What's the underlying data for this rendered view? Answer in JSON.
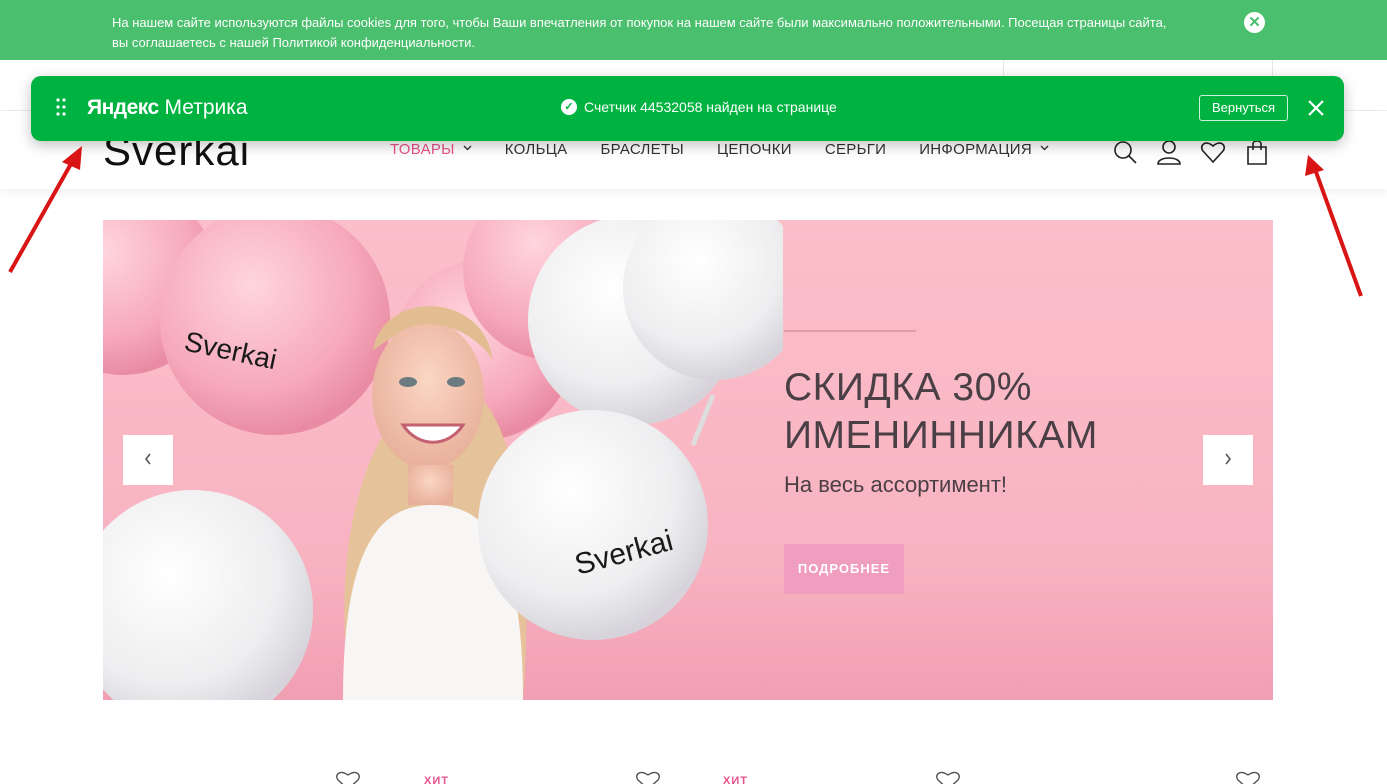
{
  "cookie": {
    "line1": "На нашем сайте используются файлы cookies для того, чтобы Ваши впечатления от покупок на нашем сайте были максимально положительными. Посещая страницы сайта,",
    "line2": "вы соглашаетесь с нашей Политикой конфиденциальности.",
    "close_icon": "✕"
  },
  "metrika": {
    "logo_yandex": "Яндекс",
    "logo_metrika": "Метрика",
    "message": "Счетчик 44532058 найден на странице",
    "back_label": "Вернуться",
    "check_icon": "✓",
    "accent": "#00b341"
  },
  "header": {
    "logo": "Sverkai",
    "nav": [
      {
        "label": "ТОВАРЫ"
      },
      {
        "label": "КОЛЬЦА"
      },
      {
        "label": "БРАСЛЕТЫ"
      },
      {
        "label": "ЦЕПОЧКИ"
      },
      {
        "label": "СЕРЬГИ"
      },
      {
        "label": "ИНФОРМАЦИЯ"
      }
    ],
    "chevron_icon": "⌄",
    "icons": [
      "search-icon",
      "user-icon",
      "heart-icon",
      "bag-icon"
    ]
  },
  "hero": {
    "title_line1": "СКИДКА 30%",
    "title_line2": "ИМЕНИННИКАМ",
    "subtitle": "На весь ассортимент!",
    "button": "ПОДРОБНЕЕ",
    "balloon_text": "Sverkai",
    "prev_icon": "‹",
    "next_icon": "›",
    "bg_color": "#fbbfca"
  },
  "products": {
    "badge": "ХИТ"
  }
}
